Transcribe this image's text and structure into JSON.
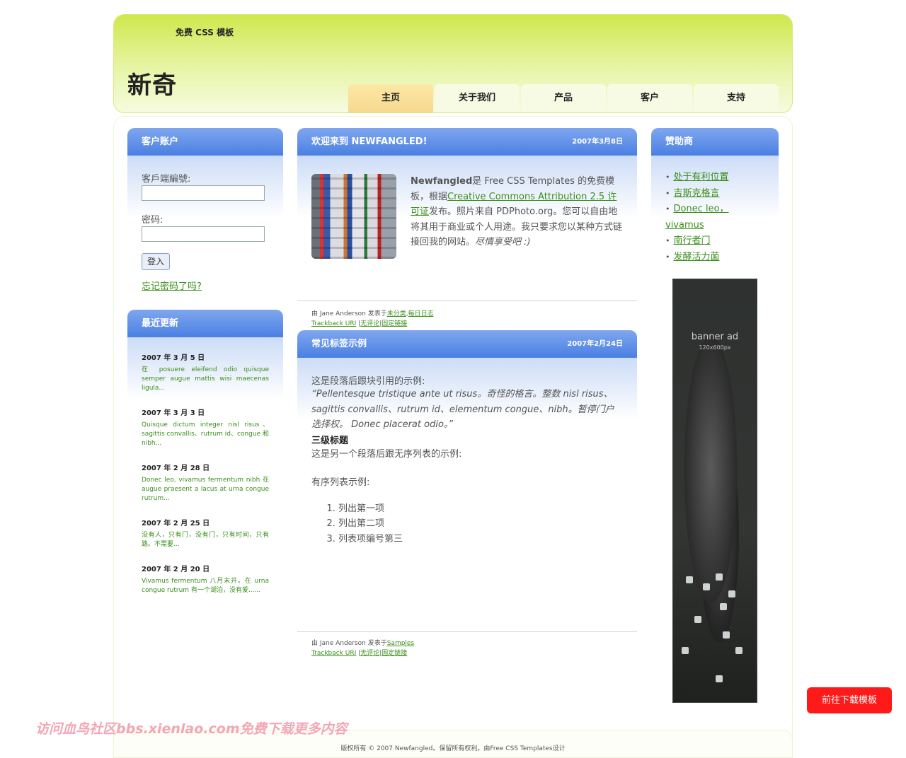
{
  "header": {
    "slogan": "免费 CSS 模板",
    "logo": "新奇",
    "menu": [
      "主页",
      "关于我们",
      "产品",
      "客户",
      "支持"
    ]
  },
  "login": {
    "title": "客户账户",
    "client_label": "客戶端編號:",
    "password_label": "密码:",
    "button": "登入",
    "forgot": "忘记密码了吗? "
  },
  "updates": {
    "title": "最近更新",
    "items": [
      {
        "date": "2007 年 3 月 5 日",
        "text": "在 posuere eleifend odio quisque semper augue mattis wisi maecenas ligula..."
      },
      {
        "date": "2007 年 3 月 3 日",
        "text": "Quisque dictum integer nisl risus、sagittis convallis、rutrum id、congue 和 nibh..."
      },
      {
        "date": "2007 年 2 月 28 日",
        "text": "Donec leo, vivamus fermentum nibh 在 augue praesent a lacus at urna congue rutrum..."
      },
      {
        "date": "2007 年 2 月 25 日",
        "text": "没有人，只有门，没有门，只有时间，只有路。不需要..."
      },
      {
        "date": "2007 年 2 月 20 日",
        "text": "Vivamus fermentum 八月末开。在 urna congue rutrum 有一个湖泊，没有爱......"
      }
    ]
  },
  "post1": {
    "title": "欢迎来到 NEWFANGLED!",
    "date": "2007年3月8日",
    "brand": "Newfangled",
    "text1": "是 Free CSS Templates 的免费模板，根据",
    "license": "Creative Commons Attribution 2.5 许可证",
    "text2": "发布。照片来自 PDPhoto.org。您可以自由地将其用于商业或个人用途。我只要求您以某种方式链接回我的网站。",
    "enjoy": "尽情享受吧 :)",
    "meta_by": "由 Jane Anderson 发表于",
    "cat1": "未分类",
    "cat2": "每日日志",
    "trackback": "Trackback URI",
    "comments": "无评论",
    "permalink": "固定链接"
  },
  "post2": {
    "title": "常见标签示例",
    "date": "2007年2月24日",
    "intro": "这是段落后跟块引用的示例:",
    "quote": "“Pellentesque tristique ante ut risus。奇怪的格言。整数 nisl risus、sagittis convallis、rutrum id、elementum congue、nibh。暂停门户选择权。 Donec placerat odio。”",
    "heading": "三级标题",
    "list_intro": "这是另一个段落后跟无序列表的示例:",
    "ordered_intro": "有序列表示例:",
    "ordered": [
      "列出第一项",
      "列出第二项",
      "列表项编号第三"
    ],
    "meta_by": "由 Jane Anderson 发表于",
    "cat1": "Samples",
    "trackback": "Trackback URI",
    "comments": "无评论",
    "permalink": "固定链接"
  },
  "sponsors": {
    "title": "赞助商",
    "items": [
      "处于有利位置",
      "吉斯克格言",
      "Donec leo，vivamus",
      "南行者门",
      "发酵活力菌"
    ]
  },
  "banner": {
    "title": "banner ad",
    "size": "120x600px"
  },
  "download_button": "前往下载模板",
  "watermark": "访问血鸟社区bbs.xienlao.com免费下载更多内容",
  "footer": "版权所有 © 2007 Newfangled。保留所有权利。由Free CSS Templates设计"
}
